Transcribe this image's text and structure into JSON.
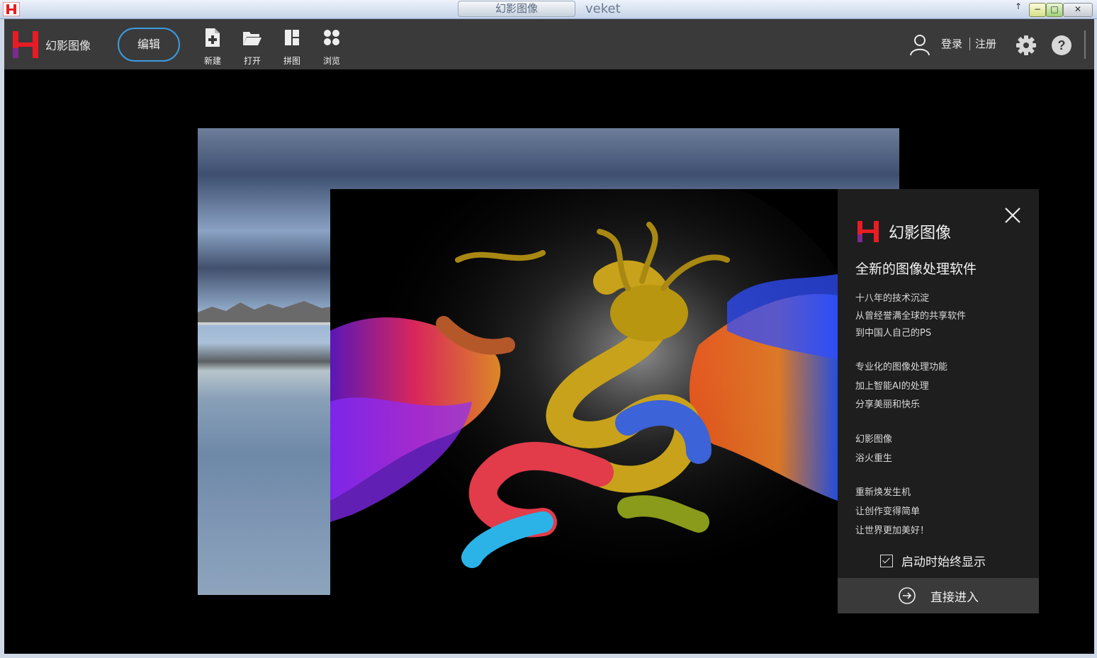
{
  "os": {
    "window_title": "幻影图像",
    "system_name": "veket",
    "buttons": {
      "minimize": "−",
      "maximize": "□",
      "close": "✕",
      "up": "↑"
    }
  },
  "toolbar": {
    "app_name": "幻影图像",
    "edit_label": "编辑",
    "tools": [
      {
        "label": "新建",
        "icon": "new-file-icon"
      },
      {
        "label": "打开",
        "icon": "folder-open-icon"
      },
      {
        "label": "拼图",
        "icon": "collage-icon"
      },
      {
        "label": "浏览",
        "icon": "browse-icon"
      }
    ],
    "login": "登录",
    "register": "注册"
  },
  "splash": {
    "title": "幻影图像",
    "subtitle": "全新的图像处理软件",
    "lines": [
      "十八年的技术沉淀",
      "从曾经誉满全球的共享软件",
      "到中国人自己的PS",
      "专业化的图像处理功能",
      "加上智能AI的处理",
      "分享美丽和快乐",
      "幻影图像",
      "浴火重生",
      "重新焕发生机",
      "让创作变得简单",
      "让世界更加美好！"
    ],
    "show_on_startup": "启动时始终显示",
    "show_on_startup_checked": true,
    "enter_label": "直接进入"
  },
  "colors": {
    "accent": "#3c9be0",
    "logo_red": "#e81c24",
    "logo_purple": "#7a2b8f",
    "toolbar_bg": "#3a3a3a",
    "panel_bg": "#1e1e1e"
  }
}
